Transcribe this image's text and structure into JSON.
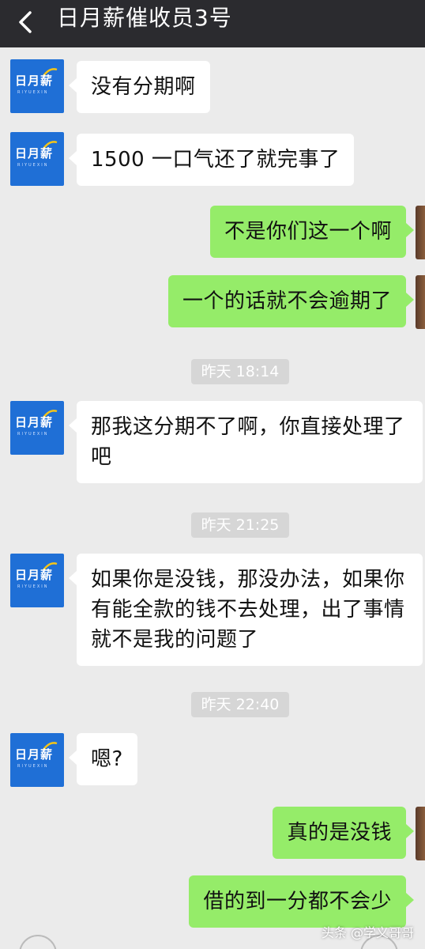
{
  "header": {
    "title": "日月薪催收员3号",
    "back_icon": "chevron-left-icon"
  },
  "contact": {
    "avatar_text": "日月薪",
    "avatar_subtext": "RIYUEXIN",
    "avatar_color": "#1f6fd6"
  },
  "colors": {
    "incoming_bubble": "#ffffff",
    "outgoing_bubble": "#95ec69",
    "background": "#ebebeb",
    "header": "#2b2b2f"
  },
  "messages": [
    {
      "from": "contact",
      "text": "没有分期啊"
    },
    {
      "from": "contact",
      "text": "1500 一口气还了就完事了"
    },
    {
      "from": "self",
      "text": "不是你们这一个啊"
    },
    {
      "from": "self",
      "text": "一个的话就不会逾期了"
    },
    {
      "type": "time",
      "text": "昨天 18:14"
    },
    {
      "from": "contact",
      "text": "那我这分期不了啊，你直接处理了吧"
    },
    {
      "type": "time",
      "text": "昨天 21:25"
    },
    {
      "from": "contact",
      "text": "如果你是没钱，那没办法，如果你有能全款的钱不去处理，出了事情就不是我的问题了"
    },
    {
      "type": "time",
      "text": "昨天 22:40"
    },
    {
      "from": "contact",
      "text": "嗯?"
    },
    {
      "from": "self",
      "text": "真的是没钱"
    },
    {
      "from": "self",
      "text": "借的到一分都不会少"
    }
  ],
  "watermark": "头条 @学义哥哥"
}
